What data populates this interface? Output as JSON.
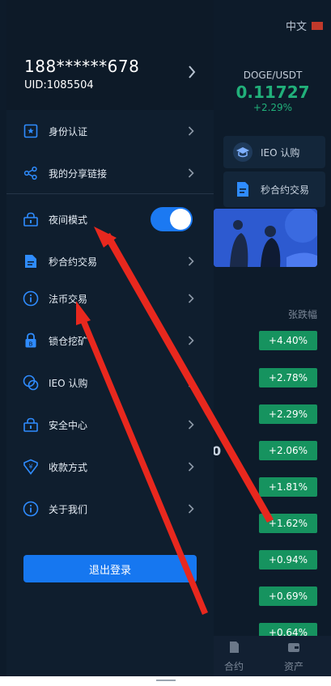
{
  "background": {
    "language": "中文",
    "ticker": {
      "pair": "DOGE/USDT",
      "price": "0.11727",
      "change": "+2.29%"
    },
    "quick_buttons": [
      "IEO 认购",
      "秒合约交易"
    ],
    "column_header": "张跌幅",
    "changes": [
      "+4.40%",
      "+2.78%",
      "+2.29%",
      "+2.06%",
      "+1.81%",
      "+1.62%",
      "+0.94%",
      "+0.69%",
      "+0.64%"
    ],
    "partial_value": "0",
    "tabs": [
      "合约",
      "资产"
    ]
  },
  "drawer": {
    "phone": "188******678",
    "uid": "UID:1085504",
    "menu": [
      {
        "label": "身份认证",
        "icon": "id-card-icon"
      },
      {
        "label": "我的分享链接",
        "icon": "share-icon"
      },
      {
        "label": "夜间模式",
        "icon": "lock-icon"
      },
      {
        "label": "秒合约交易",
        "icon": "document-icon"
      },
      {
        "label": "法币交易",
        "icon": "info-icon"
      },
      {
        "label": "锁仓挖矿",
        "icon": "padlock-icon"
      },
      {
        "label": "IEO 认购",
        "icon": "circles-icon"
      },
      {
        "label": "安全中心",
        "icon": "lock-icon"
      },
      {
        "label": "收款方式",
        "icon": "wallet-icon"
      },
      {
        "label": "关于我们",
        "icon": "info-icon"
      }
    ],
    "night_mode_on": true,
    "logout": "退出登录"
  },
  "colors": {
    "accent": "#1677f0",
    "green": "#16935f",
    "annotation": "#e8281e"
  }
}
